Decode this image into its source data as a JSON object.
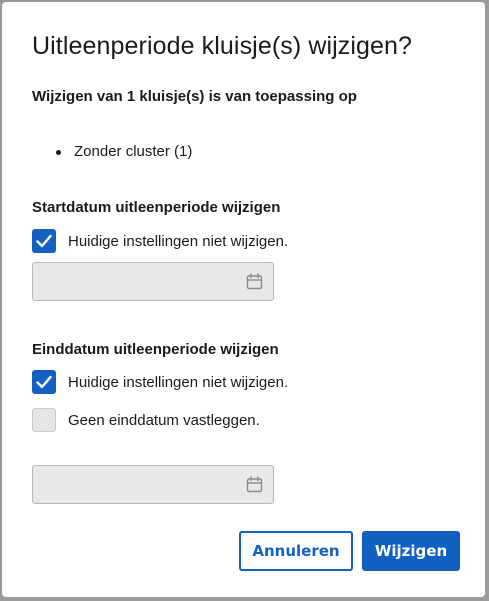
{
  "dialog": {
    "title": "Uitleenperiode kluisje(s) wijzigen?",
    "applies_to": "Wijzigen van 1 kluisje(s) is van toepassing op",
    "clusters": [
      "Zonder cluster (1)"
    ]
  },
  "start_section": {
    "label": "Startdatum uitleenperiode wijzigen",
    "keep_current": {
      "label": "Huidige instellingen niet wijzigen.",
      "checked": true
    },
    "date_value": ""
  },
  "end_section": {
    "label": "Einddatum uitleenperiode wijzigen",
    "keep_current": {
      "label": "Huidige instellingen niet wijzigen.",
      "checked": true
    },
    "no_end_date": {
      "label": "Geen einddatum vastleggen.",
      "checked": false
    },
    "date_value": ""
  },
  "actions": {
    "cancel_label": "Annuleren",
    "submit_label": "Wijzigen"
  },
  "icons": {
    "checkmark": "checkmark-icon",
    "calendar": "calendar-icon"
  },
  "colors": {
    "accent": "#1261c1",
    "disabled_field": "#e8e8e8"
  }
}
